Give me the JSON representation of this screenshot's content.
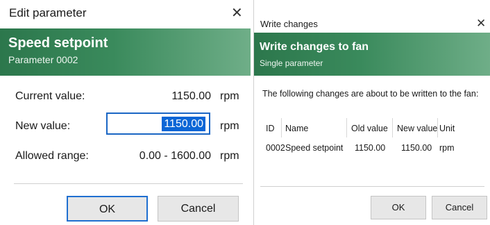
{
  "edit_dialog": {
    "title": "Edit parameter",
    "close_glyph": "✕",
    "header_title": "Speed setpoint",
    "header_subtitle": "Parameter 0002",
    "current_label": "Current value:",
    "current_value": "1150.00",
    "current_unit": "rpm",
    "new_label": "New value:",
    "new_value": "1150.00",
    "new_unit": "rpm",
    "range_label": "Allowed range:",
    "range_value": "0.00 - 1600.00",
    "range_unit": "rpm",
    "ok_label": "OK",
    "cancel_label": "Cancel"
  },
  "write_dialog": {
    "title": "Write changes",
    "close_glyph": "✕",
    "header_title": "Write changes to fan",
    "header_subtitle": "Single parameter",
    "intro": "The following changes are about to be written to the fan:",
    "columns": [
      "ID",
      "Name",
      "Old value",
      "New value",
      "Unit"
    ],
    "rows": [
      [
        "0002",
        "Speed setpoint",
        "1150.00",
        "1150.00",
        "rpm"
      ]
    ],
    "ok_label": "OK",
    "cancel_label": "Cancel"
  },
  "colors": {
    "header_green": "#2c774c",
    "focus_blue": "#1f6fd0",
    "selection_blue": "#0b66d6"
  }
}
